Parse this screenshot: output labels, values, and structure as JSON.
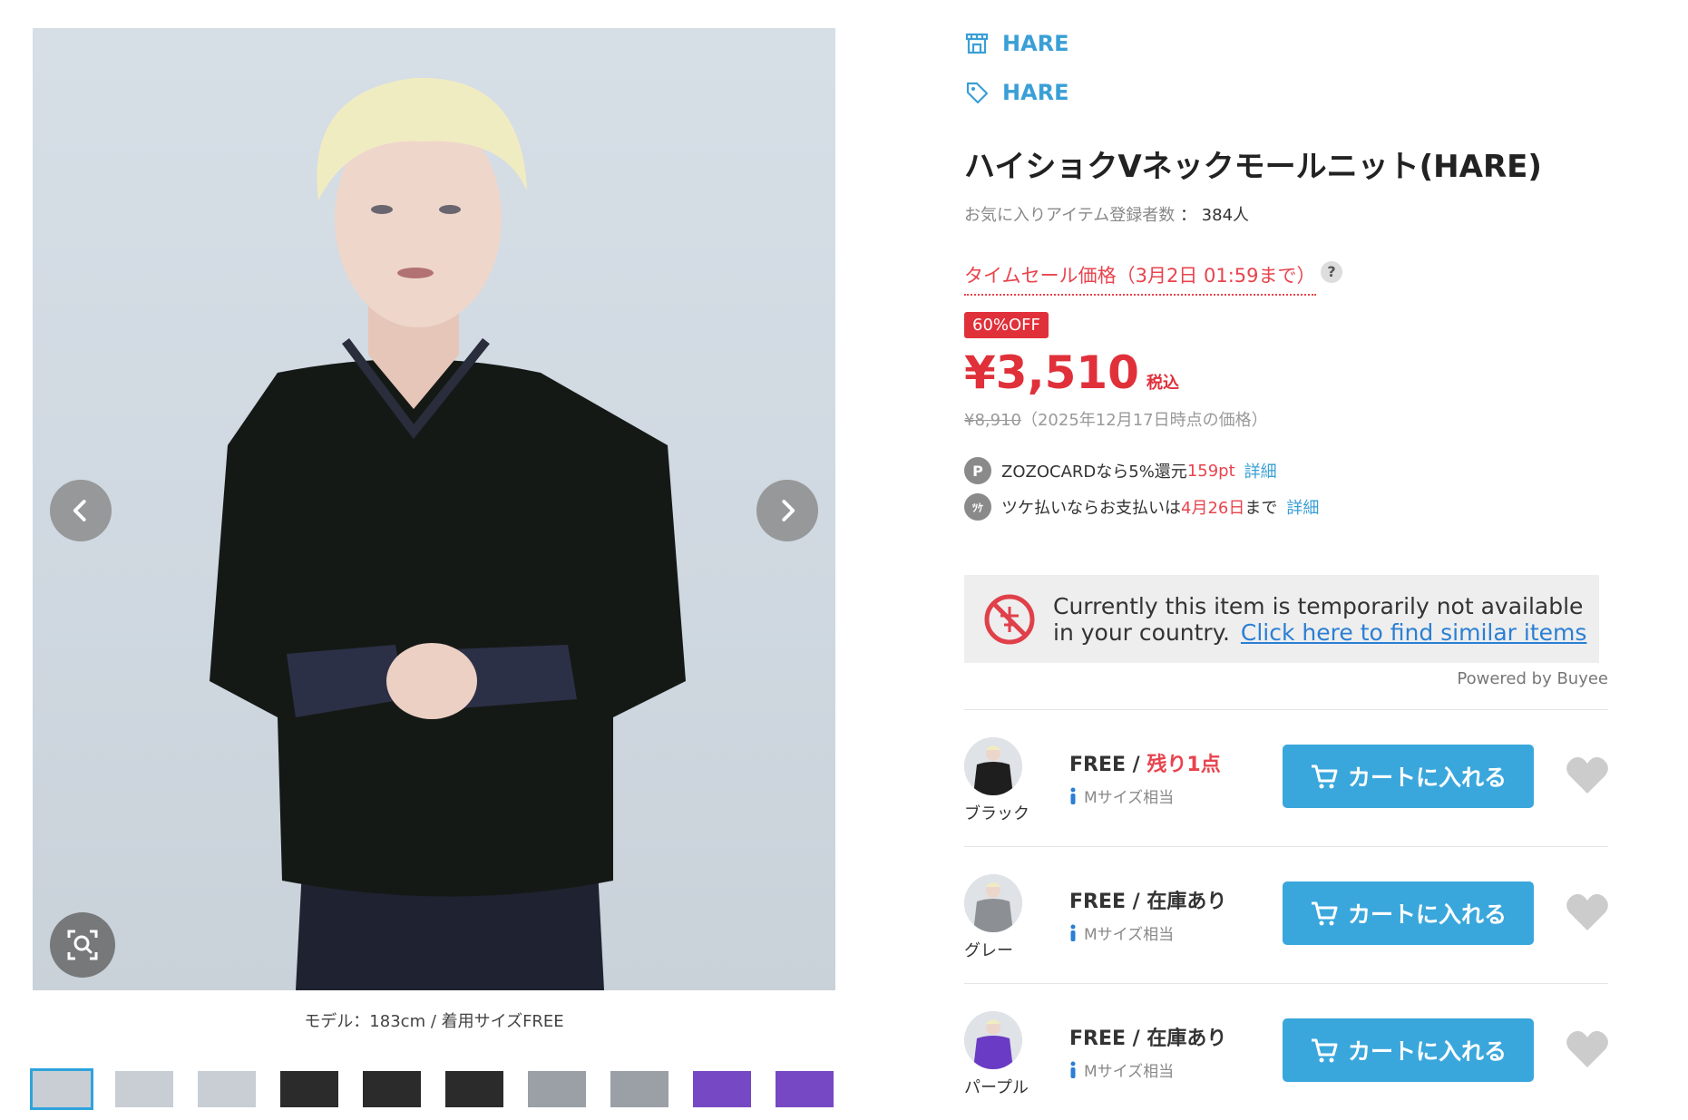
{
  "gallery": {
    "caption": "モデル：183cm / 着用サイズFREE",
    "prev_icon": "chevron-left-icon",
    "next_icon": "chevron-right-icon",
    "zoom_icon": "zoom-search-icon",
    "thumbnail_count": 10
  },
  "product": {
    "shop_name": "HARE",
    "brand_name": "HARE",
    "title": "ハイショクVネックモールニット(HARE)",
    "favorites_label": "お気に入りアイテム登録者数",
    "favorites_sep": "：",
    "favorites_count": "384人",
    "sale_label": "タイムセール価格（3月2日 01:59まで）",
    "help": "?",
    "discount_badge": "60%OFF",
    "price": "¥3,510",
    "tax_label": "税込",
    "original_price": "¥8,910",
    "original_note": "（2025年12月17日時点の価格）"
  },
  "perks": [
    {
      "icon_text": "P",
      "text": "ZOZOCARDなら5%還元",
      "highlight": "159pt",
      "suffix": "",
      "link": "詳細"
    },
    {
      "icon_text": "ﾂｹ",
      "text": "ツケ払いならお支払いは",
      "highlight": "4月26日",
      "suffix": "まで",
      "link": "詳細"
    }
  ],
  "buyee": {
    "line1": "Currently this item is temporarily not available",
    "line2": "in your country.",
    "link": "Click here to find similar items",
    "powered": "Powered by Buyee"
  },
  "variants": [
    {
      "color": "ブラック",
      "size": "FREE / ",
      "stock": "残り1点",
      "stock_low": true,
      "fit": "Mサイズ相当",
      "cart": "カートに入れる",
      "swatch": "#1e1e1e"
    },
    {
      "color": "グレー",
      "size": "FREE / ",
      "stock": "在庫あり",
      "stock_low": false,
      "fit": "Mサイズ相当",
      "cart": "カートに入れる",
      "swatch": "#8c8f94"
    },
    {
      "color": "パープル",
      "size": "FREE / ",
      "stock": "在庫あり",
      "stock_low": false,
      "fit": "Mサイズ相当",
      "cart": "カートに入れる",
      "swatch": "#6a3bc4"
    }
  ],
  "colors": {
    "accent_blue": "#3aa7dc",
    "sale_red": "#e0303a"
  }
}
